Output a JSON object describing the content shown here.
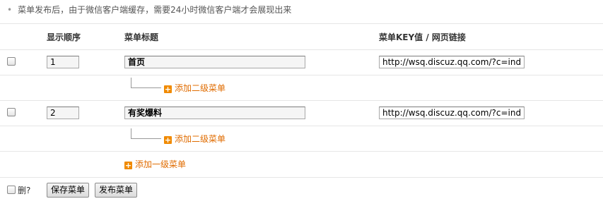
{
  "notice": "菜单发布后，由于微信客户端缓存，需要24小时微信客户端才会展现出来",
  "table": {
    "headers": {
      "order": "显示顺序",
      "title": "菜单标题",
      "key": "菜单KEY值 / 网页链接"
    },
    "rows": [
      {
        "order": "1",
        "title": "首页",
        "key": "http://wsq.discuz.qq.com/?c=ind",
        "add_sub": "添加二级菜单"
      },
      {
        "order": "2",
        "title": "有奖爆料",
        "key": "http://wsq.discuz.qq.com/?c=ind",
        "add_sub": "添加二级菜单"
      }
    ],
    "add_top": "添加一级菜单"
  },
  "footer": {
    "delete_label": "删?",
    "save_button": "保存菜单",
    "publish_button": "发布菜单"
  },
  "icons": {
    "add": "plus-icon"
  },
  "colors": {
    "accent": "#e06c00"
  }
}
